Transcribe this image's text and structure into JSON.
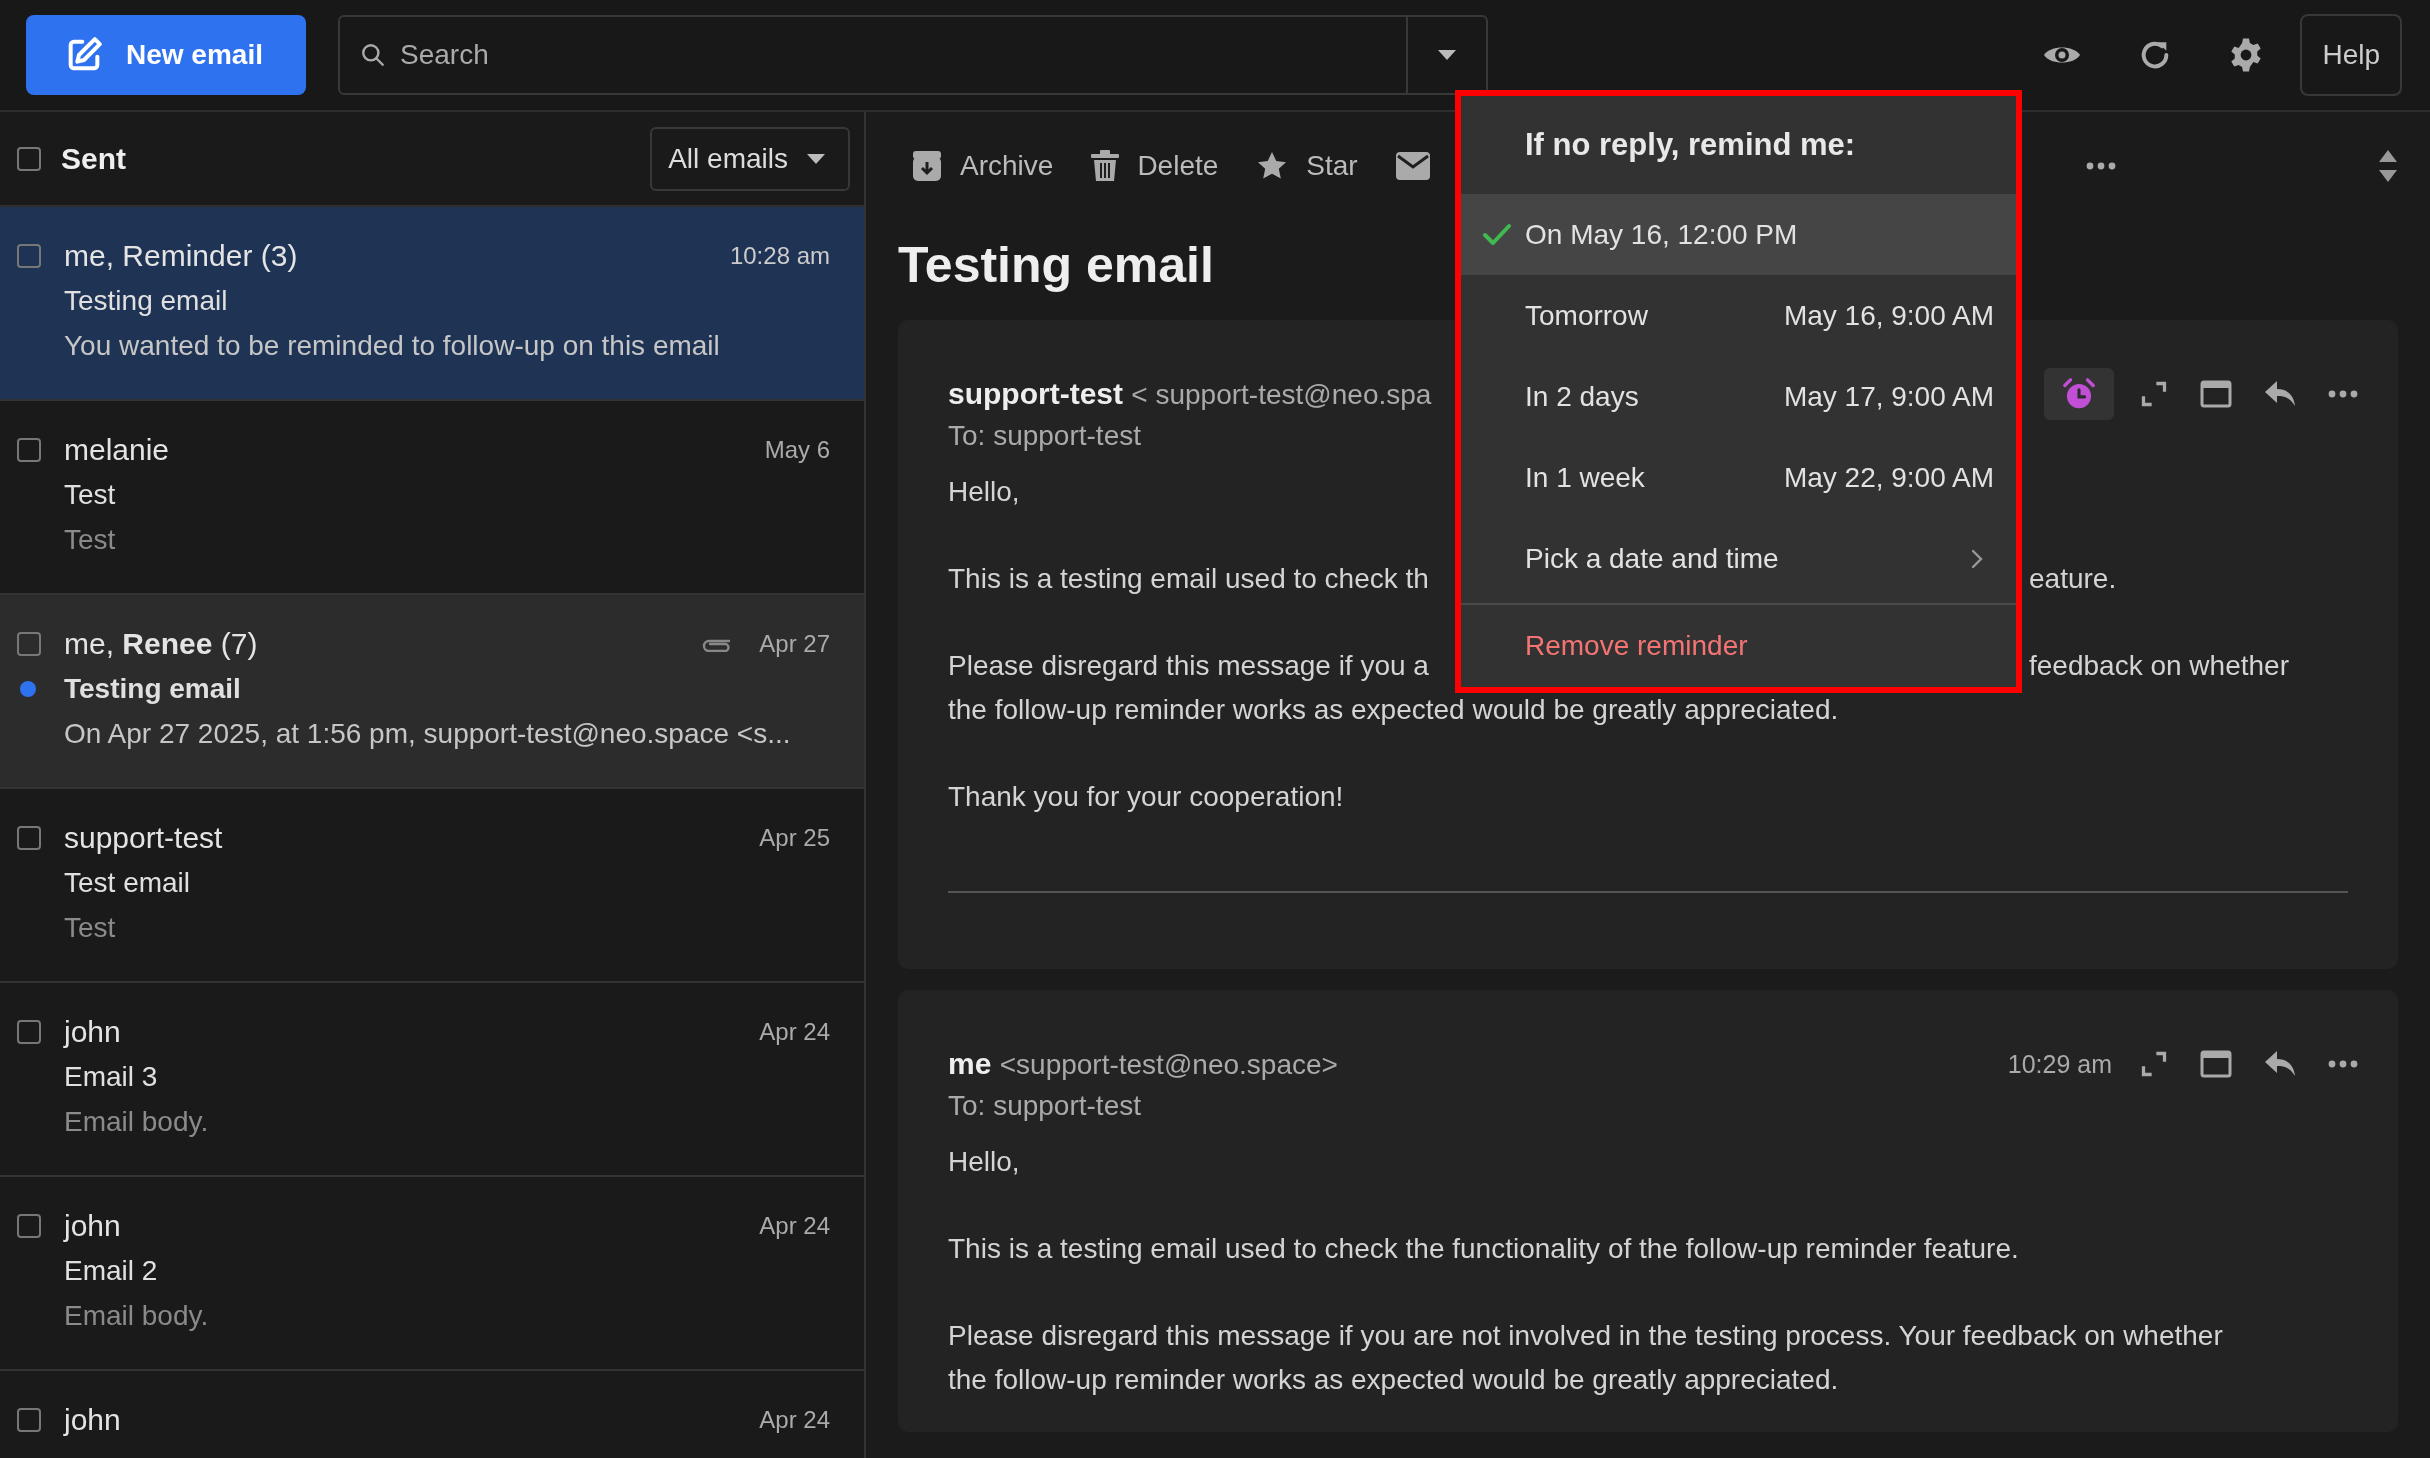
{
  "topbar": {
    "new_email_button": "New email",
    "search": {
      "placeholder": "Search"
    },
    "help_button": "Help"
  },
  "mailbox": {
    "title": "Sent",
    "all_checked": false,
    "filter": "All emails"
  },
  "emails": [
    {
      "sender": "me, Reminder (3)",
      "time": "10:28 am",
      "subject": "Testing email",
      "preview": "You wanted to be reminded to follow-up on this email",
      "checked": false,
      "selected": true,
      "highlighted": false,
      "unread": false,
      "attachment": false
    },
    {
      "sender": "melanie",
      "time": "May 6",
      "subject": "Test",
      "preview": "Test",
      "checked": false,
      "selected": false,
      "highlighted": false,
      "unread": false,
      "attachment": false
    },
    {
      "sender": "me, **Renee** (7)",
      "time": "Apr 27",
      "subject": "Testing email",
      "preview": "On Apr 27 2025, at 1:56 pm, support-test@neo.space <s...",
      "checked": false,
      "selected": false,
      "highlighted": true,
      "unread": true,
      "attachment": true
    },
    {
      "sender": "support-test",
      "time": "Apr 25",
      "subject": "Test email",
      "preview": "Test",
      "checked": false,
      "selected": false,
      "highlighted": false,
      "unread": false,
      "attachment": false
    },
    {
      "sender": "john",
      "time": "Apr 24",
      "subject": "Email 3",
      "preview": "Email body.",
      "checked": false,
      "selected": false,
      "highlighted": false,
      "unread": false,
      "attachment": false
    },
    {
      "sender": "john",
      "time": "Apr 24",
      "subject": "Email 2",
      "preview": "Email body.",
      "checked": false,
      "selected": false,
      "highlighted": false,
      "unread": false,
      "attachment": false
    },
    {
      "sender": "john",
      "time": "Apr 24",
      "checked": false,
      "selected": false,
      "highlighted": false,
      "unread": false,
      "attachment": false
    }
  ],
  "toolbar": {
    "actions": [
      {
        "kind": "archive",
        "label": "Archive"
      },
      {
        "kind": "delete",
        "label": "Delete"
      },
      {
        "kind": "star",
        "label": "Star"
      },
      {
        "kind": "mark"
      }
    ]
  },
  "thread": {
    "title": "Testing email",
    "messages": [
      {
        "sender": "support-test",
        "address": "< support-test@neo.spa",
        "to": "To: support-test",
        "reminder_set": true,
        "paragraphs": [
          [
            {
              "left": "Hello,"
            }
          ],
          [
            {
              "left": "This is a testing email used to check th",
              "right": "eature."
            }
          ],
          [
            {
              "left": "Please disregard this message if you a",
              "right": "feedback on whether"
            },
            {
              "left": "the follow-up reminder works as expected would be greatly appreciated."
            }
          ],
          [
            {
              "left": "Thank you for your cooperation!"
            }
          ]
        ]
      },
      {
        "sender": "me",
        "address": "<support-test@neo.space>",
        "time": "10:29 am",
        "to": "To: support-test",
        "reminder_set": false,
        "paragraphs": [
          [
            {
              "left": "Hello,"
            }
          ],
          [
            {
              "left": "This is a testing email used to check the functionality of the follow-up reminder feature."
            }
          ],
          [
            {
              "left": "Please disregard this message if you are not involved in the testing process. Your feedback on whether"
            },
            {
              "left": "the follow-up reminder works as expected would be greatly appreciated."
            }
          ]
        ]
      }
    ]
  },
  "reminder_menu": {
    "title": "If no reply, remind me:",
    "options": [
      {
        "kind": "option",
        "label": "On May 16, 12:00 PM",
        "selected": true
      },
      {
        "kind": "option",
        "label": "Tomorrow",
        "time": "May 16, 9:00 AM",
        "selected": false
      },
      {
        "kind": "option",
        "label": "In 2 days",
        "time": "May 17, 9:00 AM",
        "selected": false
      },
      {
        "kind": "option",
        "label": "In 1 week",
        "time": "May 22, 9:00 AM",
        "selected": false
      },
      {
        "kind": "submenu",
        "label": "Pick a date and time",
        "selected": false
      },
      {
        "kind": "action",
        "label": "Remove reminder",
        "selected": false
      }
    ]
  }
}
